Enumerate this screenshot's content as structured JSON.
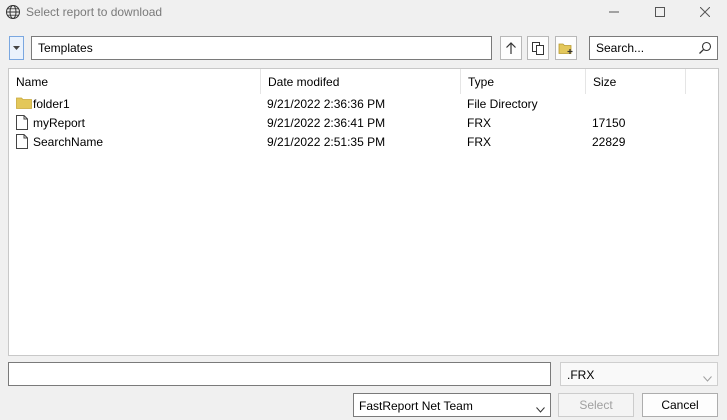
{
  "window": {
    "title": "Select report to download"
  },
  "toolbar": {
    "path_value": "Templates",
    "search_placeholder": "Search..."
  },
  "columns": {
    "name": "Name",
    "date": "Date modifed",
    "type": "Type",
    "size": "Size"
  },
  "files": [
    {
      "name": "folder1",
      "date": "9/21/2022 2:36:36 PM",
      "type": "File Directory",
      "size": "",
      "icon": "folder-icon"
    },
    {
      "name": "myReport",
      "date": "9/21/2022 2:36:41 PM",
      "type": "FRX",
      "size": "17150",
      "icon": "file-icon"
    },
    {
      "name": "SearchName",
      "date": "9/21/2022 2:51:35 PM",
      "type": "FRX",
      "size": "22829",
      "icon": "file-icon"
    }
  ],
  "footer": {
    "filename_value": "",
    "filter_value": ".FRX",
    "team_value": "FastReport Net Team",
    "select_label": "Select",
    "cancel_label": "Cancel"
  },
  "colors": {
    "folder": "#e3c75a",
    "dropdown_border": "#7aa7e0"
  }
}
